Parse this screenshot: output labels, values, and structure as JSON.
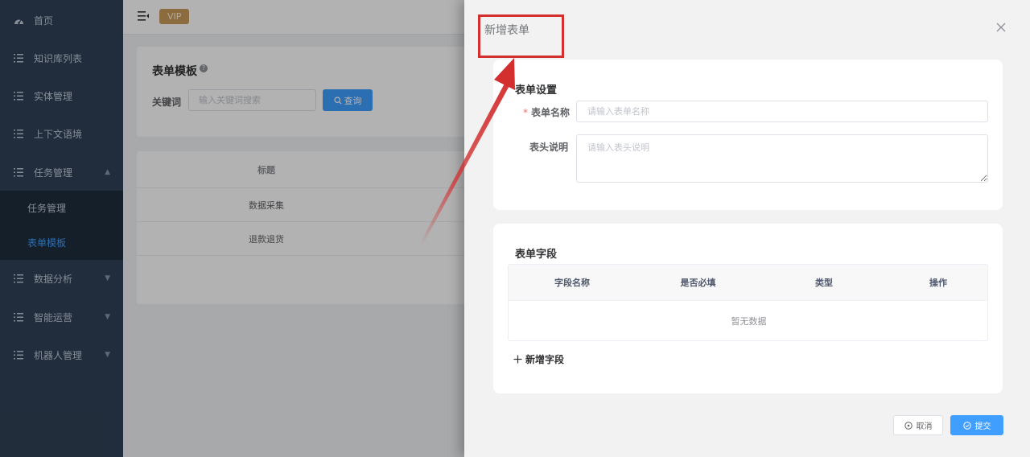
{
  "sidebar": {
    "items": [
      {
        "label": "首页",
        "icon": "dashboard-icon"
      },
      {
        "label": "知识库列表",
        "icon": "list-icon"
      },
      {
        "label": "实体管理",
        "icon": "list-icon"
      },
      {
        "label": "上下文语境",
        "icon": "list-icon"
      },
      {
        "label": "任务管理",
        "icon": "list-icon",
        "expanded": true
      },
      {
        "label": "数据分析",
        "icon": "list-icon"
      },
      {
        "label": "智能运营",
        "icon": "list-icon"
      },
      {
        "label": "机器人管理",
        "icon": "list-icon"
      }
    ],
    "subitems": [
      {
        "label": "任务管理"
      },
      {
        "label": "表单模板",
        "active": true
      }
    ]
  },
  "header": {
    "vip_label": "VIP"
  },
  "search": {
    "title": "表单模板",
    "keyword_label": "关键词",
    "placeholder": "输入关键词搜索",
    "button_label": "查询"
  },
  "table": {
    "header": "标题",
    "rows": [
      "数据采集",
      "退款退货"
    ]
  },
  "drawer": {
    "title": "新增表单",
    "settings": {
      "title": "表单设置",
      "name_label": "表单名称",
      "name_placeholder": "请输入表单名称",
      "desc_label": "表头说明",
      "desc_placeholder": "请输入表头说明"
    },
    "fields": {
      "title": "表单字段",
      "columns": [
        "字段名称",
        "是否必填",
        "类型",
        "操作"
      ],
      "empty_text": "暂无数据",
      "add_label": "新增字段"
    },
    "cancel_label": "取消",
    "submit_label": "提交"
  },
  "colors": {
    "sidebar_bg": "#304156",
    "primary": "#409eff",
    "vip": "#c99a5b",
    "annotation": "#d32f2f"
  }
}
